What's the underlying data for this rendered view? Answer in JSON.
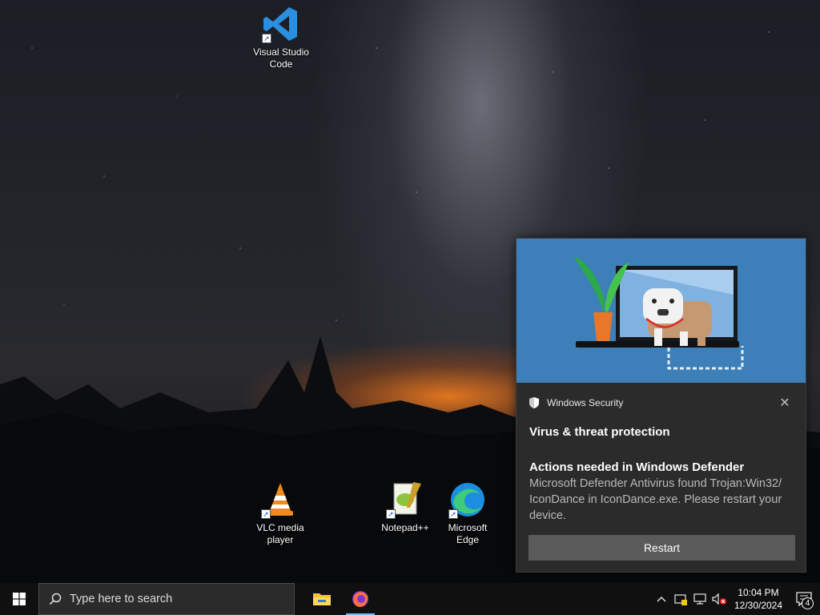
{
  "desktop": {
    "icons": [
      {
        "label": "Visual Studio\nCode",
        "icon": "vscode-icon"
      },
      {
        "label": "VLC media\nplayer",
        "icon": "vlc-icon"
      },
      {
        "label": "Notepad++",
        "icon": "notepadpp-icon"
      },
      {
        "label": "Microsoft\nEdge",
        "icon": "edge-icon"
      }
    ]
  },
  "toast": {
    "app_name": "Windows Security",
    "title": "Virus & threat protection",
    "heading": "Actions needed in Windows Defender",
    "body": "Microsoft Defender Antivirus found Trojan:Win32/\nIconDance in IconDance.exe. Please restart your\ndevice.",
    "button_label": "Restart",
    "close_icon": "close-icon",
    "hero_color": "#3d7fb8"
  },
  "taskbar": {
    "search_placeholder": "Type here to search",
    "pinned": [
      {
        "name": "file-explorer-icon"
      },
      {
        "name": "firefox-icon",
        "active": true
      }
    ],
    "clock": {
      "time": "10:04 PM",
      "date": "12/30/2024"
    },
    "notification_count": "4"
  }
}
